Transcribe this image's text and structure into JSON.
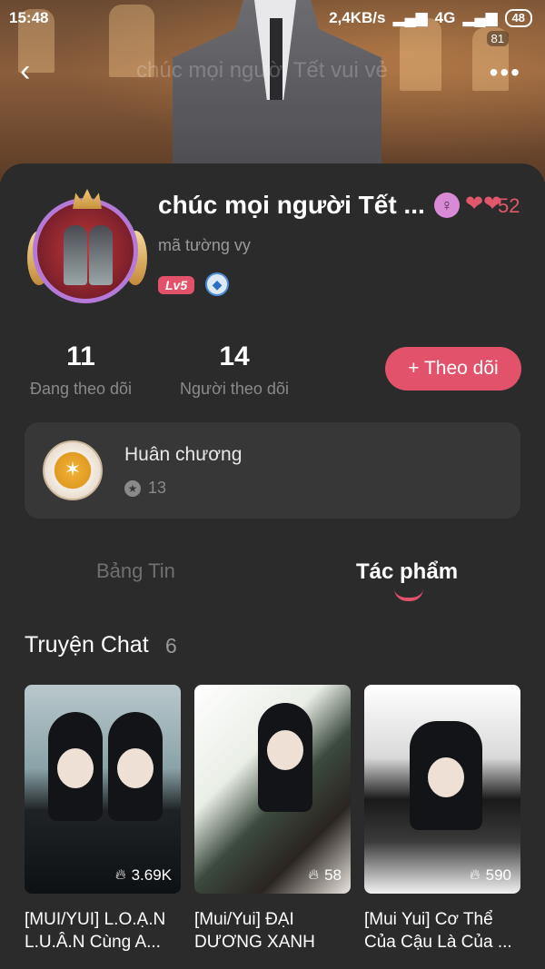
{
  "status_bar": {
    "time": "15:48",
    "net_speed": "2,4KB/s",
    "signal": "4G",
    "battery": "48",
    "notification_count": "81"
  },
  "nav": {
    "back_icon": "back-arrow-icon",
    "title": "chúc mọi người Tết vui vẻ",
    "more_icon": "more-dots-icon"
  },
  "profile": {
    "display_name": "chúc mọi người Tết ...",
    "sub_name": "mã tường vy",
    "level": "Lv5",
    "hearts": "52",
    "gender_icon": "female-icon",
    "gem_icon": "gem-icon"
  },
  "stats": {
    "following_count": "11",
    "following_label": "Đang theo dõi",
    "followers_count": "14",
    "followers_label": "Người theo dõi",
    "follow_button": "+ Theo dõi"
  },
  "medal": {
    "title": "Huân chương",
    "count": "13"
  },
  "tabs": [
    {
      "label": "Bảng Tin",
      "active": false
    },
    {
      "label": "Tác phẩm",
      "active": true
    }
  ],
  "section": {
    "title": "Truyện Chat",
    "count": "6"
  },
  "stories": [
    {
      "title": "[MUI/YUI] L.O.Ạ.N L.U.Â.N Cùng A...",
      "views": "3.69K"
    },
    {
      "title": "[Mui/Yui] ĐẠI DƯƠNG XANH",
      "views": "58"
    },
    {
      "title": "[Mui Yui] Cơ Thể Của Cậu Là Của ...",
      "views": "590"
    }
  ],
  "colors": {
    "accent": "#e2526a",
    "background": "#2b2b2c",
    "card": "#373738"
  }
}
